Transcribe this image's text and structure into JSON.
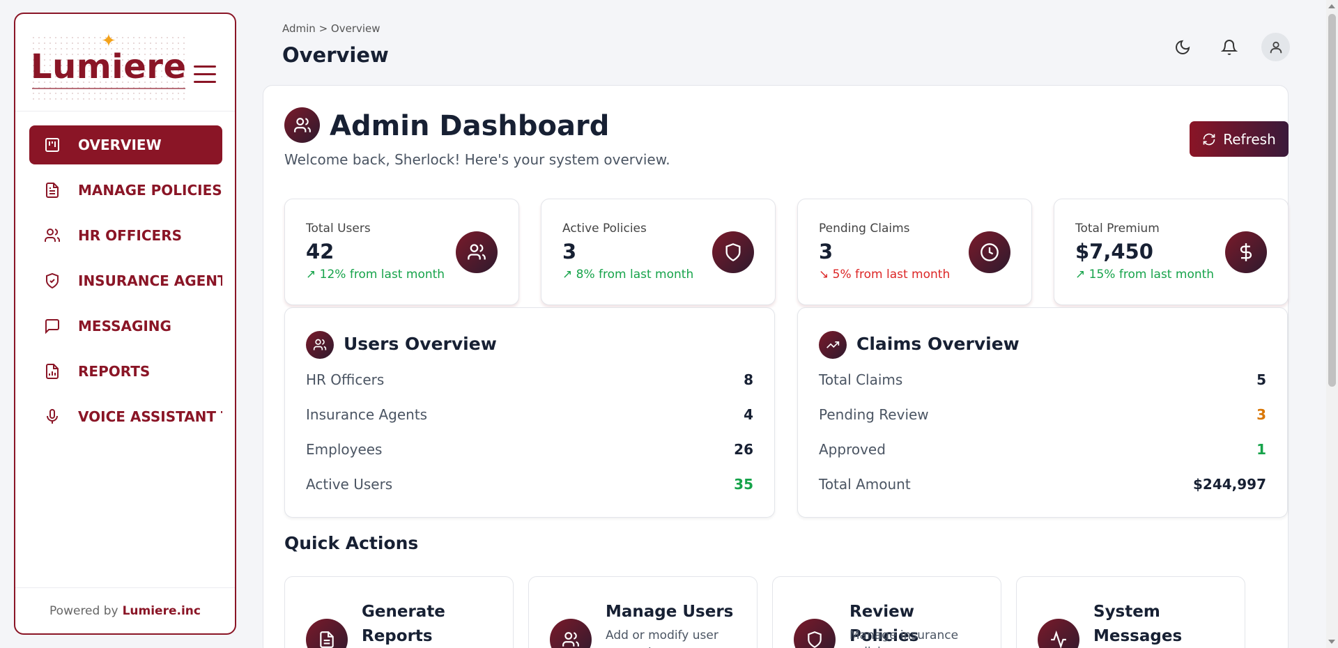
{
  "brand": {
    "logo": "Lumiere",
    "accent": "#8a1526",
    "star_color": "#f3a21a"
  },
  "sidebar": {
    "items": [
      {
        "label": "OVERVIEW",
        "icon": "overview-icon",
        "active": true
      },
      {
        "label": "MANAGE POLICIES",
        "icon": "document-icon"
      },
      {
        "label": "HR OFFICERS",
        "icon": "users-icon"
      },
      {
        "label": "INSURANCE AGENTS",
        "icon": "shield-check-icon"
      },
      {
        "label": "MESSAGING",
        "icon": "message-icon"
      },
      {
        "label": "REPORTS",
        "icon": "report-icon"
      },
      {
        "label": "VOICE ASSISTANT TEST",
        "icon": "microphone-icon"
      }
    ],
    "footer_prefix": "Powered by",
    "footer_brand": "Lumiere.inc"
  },
  "header": {
    "breadcrumb": "Admin > Overview",
    "title": "Overview"
  },
  "dashboard": {
    "title": "Admin Dashboard",
    "subtitle": "Welcome back, Sherlock! Here's your system overview.",
    "refresh_label": "Refresh"
  },
  "stats": [
    {
      "label": "Total Users",
      "value": "42",
      "change": "12% from last month",
      "direction": "up",
      "icon": "users-icon"
    },
    {
      "label": "Active Policies",
      "value": "3",
      "change": "8% from last month",
      "direction": "up",
      "icon": "shield-icon"
    },
    {
      "label": "Pending Claims",
      "value": "3",
      "change": "5% from last month",
      "direction": "down",
      "icon": "clock-icon"
    },
    {
      "label": "Total Premium",
      "value": "$7,450",
      "change": "15% from last month",
      "direction": "up",
      "icon": "dollar-icon"
    }
  ],
  "users_overview": {
    "title": "Users Overview",
    "rows": [
      {
        "label": "HR Officers",
        "value": "8"
      },
      {
        "label": "Insurance Agents",
        "value": "4"
      },
      {
        "label": "Employees",
        "value": "26"
      },
      {
        "label": "Active Users",
        "value": "35"
      }
    ]
  },
  "claims_overview": {
    "title": "Claims Overview",
    "rows": [
      {
        "label": "Total Claims",
        "value": "5"
      },
      {
        "label": "Pending Review",
        "value": "3"
      },
      {
        "label": "Approved",
        "value": "1"
      },
      {
        "label": "Total Amount",
        "value": "$244,997"
      }
    ]
  },
  "colors": {
    "up": "#16a34a",
    "down": "#dc2626",
    "pending": "#d97706",
    "positive": "#16a34a"
  },
  "quick_actions": {
    "title": "Quick Actions",
    "items": [
      {
        "name": "Generate Reports",
        "desc": "",
        "icon": "report-icon"
      },
      {
        "name": "Manage Users",
        "desc": "Add or modify user accounts",
        "icon": "users-icon"
      },
      {
        "name": "Review Policies",
        "desc": "Manage insurance policies",
        "icon": "shield-icon"
      },
      {
        "name": "System Messages",
        "desc": "",
        "icon": "activity-icon"
      }
    ]
  }
}
